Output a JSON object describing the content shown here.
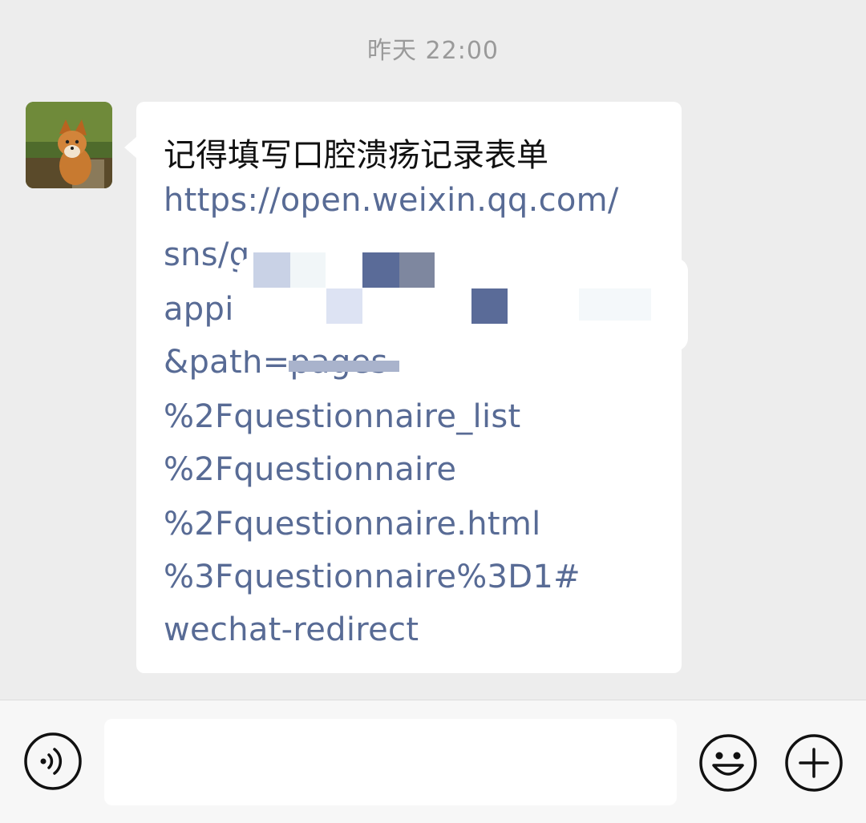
{
  "chat": {
    "timestamp": "昨天 22:00",
    "message": {
      "title": "记得填写口腔溃疡记录表单",
      "link_lines": [
        "https://open.weixin.qq.com/",
        "sns/g",
        "appi",
        "&path=pages",
        "%2Fquestionnaire_list",
        "%2Fquestionnaire",
        "%2Fquestionnaire.html",
        "%3Fquestionnaire%3D1#",
        "wechat-redirect"
      ]
    }
  },
  "input_bar": {
    "voice_icon": "voice-wave-icon",
    "emoji_icon": "smiley-face-icon",
    "plus_icon": "plus-circle-icon",
    "input_value": ""
  },
  "colors": {
    "background": "#ededed",
    "bubble": "#ffffff",
    "link": "#586b95",
    "timestamp": "#9a9a9a"
  }
}
